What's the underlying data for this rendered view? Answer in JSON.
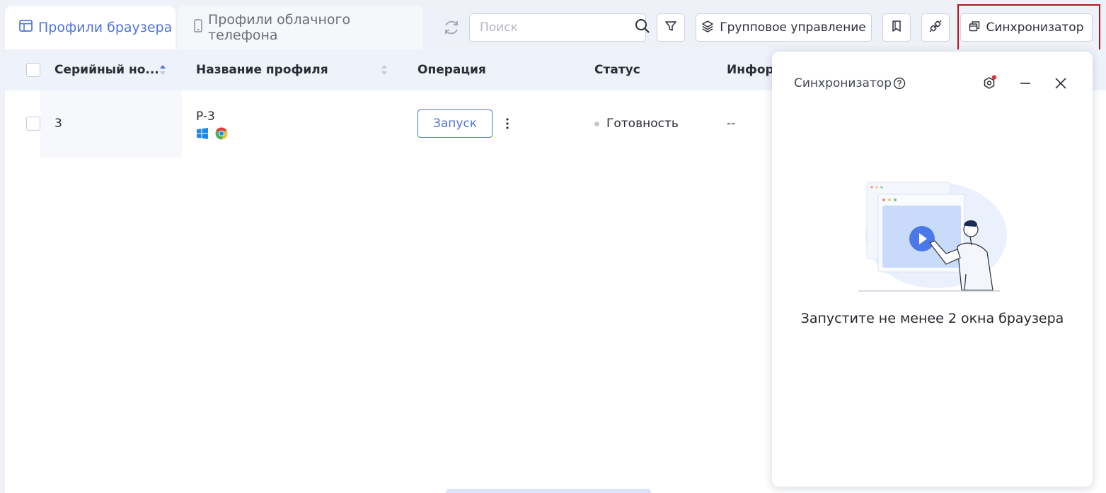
{
  "tabs": [
    {
      "label": "Профили браузера",
      "icon": "browser-window-icon",
      "active": true
    },
    {
      "label": "Профили облачного телефона",
      "icon": "phone-icon",
      "active": false
    }
  ],
  "toolbar": {
    "search_placeholder": "Поиск",
    "group_label": "Групповое управление",
    "sync_label": "Синхронизатор",
    "icons": [
      "refresh-icon",
      "search-icon",
      "filter-icon",
      "layers-icon",
      "bookmark-icon",
      "link-icon",
      "sync-windows-icon"
    ]
  },
  "table": {
    "columns": [
      "Серийный но...",
      "Название профиля",
      "Операция",
      "Статус",
      "Инфор"
    ],
    "rows": [
      {
        "serial": "3",
        "name": "P-3",
        "os": "windows-icon",
        "browser": "chrome-icon",
        "action": "Запуск",
        "status": "Готовность",
        "info": "--"
      }
    ]
  },
  "sync_panel": {
    "title": "Синхронизатор",
    "empty_message": "Запустите не менее 2 окна браузера"
  },
  "colors": {
    "accent": "#4f74d8",
    "background": "#eef1f8",
    "highlight": "#b3161f",
    "notification": "#e0303a"
  }
}
